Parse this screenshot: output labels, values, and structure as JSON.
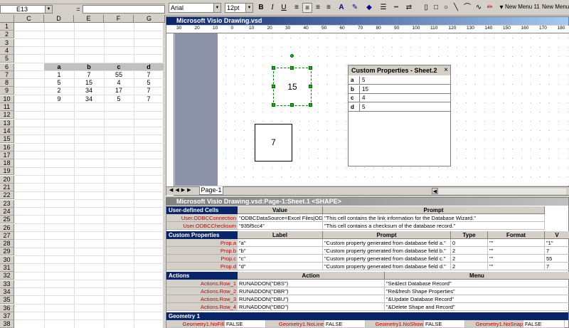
{
  "excel": {
    "name_box": "E13",
    "formula_eq": "=",
    "columns": [
      "C",
      "D",
      "E",
      "F",
      "G"
    ],
    "rows": [
      "1",
      "2",
      "3",
      "4",
      "5",
      "6",
      "7",
      "8",
      "9",
      "10",
      "11",
      "12",
      "13",
      "14",
      "15",
      "16",
      "17",
      "18",
      "19",
      "20",
      "21",
      "22",
      "23",
      "24",
      "25",
      "26",
      "27",
      "28",
      "29",
      "30",
      "31",
      "32",
      "33",
      "34",
      "35",
      "36",
      "37",
      "38"
    ],
    "table_headers": [
      "a",
      "b",
      "c",
      "d"
    ],
    "table_rows": [
      [
        "1",
        "7",
        "55",
        "7"
      ],
      [
        "5",
        "15",
        "4",
        "5"
      ],
      [
        "2",
        "34",
        "17",
        "7"
      ],
      [
        "9",
        "34",
        "5",
        "7"
      ]
    ]
  },
  "toolbar": {
    "font": "Arial",
    "size": "12pt",
    "bold": "B",
    "italic": "I",
    "underline": "U",
    "menu1": "New Menu 11",
    "menu2": "New Menu"
  },
  "visio": {
    "title": "Microsoft Visio Drawing.vsd",
    "ruler_marks": [
      "30",
      "20",
      "10",
      "0",
      "10",
      "20",
      "30",
      "40",
      "50",
      "60",
      "70",
      "80",
      "90",
      "100",
      "110",
      "120",
      "130",
      "140",
      "150",
      "160",
      "170",
      "180"
    ],
    "shape1_text": "15",
    "shape2_text": "7",
    "page_tab": "Page-1"
  },
  "custom_props": {
    "title": "Custom Properties - Sheet.2",
    "close": "×",
    "rows": [
      {
        "k": "a",
        "v": "5"
      },
      {
        "k": "b",
        "v": "15"
      },
      {
        "k": "c",
        "v": "4"
      },
      {
        "k": "d",
        "v": "5"
      }
    ]
  },
  "shapesheet": {
    "title": "Microsoft Visio Drawing.vsd:Page-1:Sheet.1 <SHAPE>",
    "user_section": "User-defined Cells",
    "user_cols": [
      "Value",
      "Prompt"
    ],
    "user_rows": [
      {
        "name": "User.ODBCConnection",
        "value": "\"ODBCDataSource=Excel Files|ODBC",
        "prompt": "\"This cell contains the link information for the Database Wizard.\""
      },
      {
        "name": "User.ODBCChecksum",
        "value": "\"935f5cc4\"",
        "prompt": "\"This cell contains a checksum of the database record.\""
      }
    ],
    "props_section": "Custom Properties",
    "props_cols": [
      "Label",
      "Prompt",
      "Type",
      "Format",
      "V"
    ],
    "props_rows": [
      {
        "name": "Prop.a",
        "label": "\"a\"",
        "prompt": "\"Custom property generated from database field a.\"",
        "type": "0",
        "format": "\"\"",
        "val": "\"1\""
      },
      {
        "name": "Prop.b",
        "label": "\"b\"",
        "prompt": "\"Custom property generated from database field b.\"",
        "type": "2",
        "format": "\"\"",
        "val": "7"
      },
      {
        "name": "Prop.c",
        "label": "\"c\"",
        "prompt": "\"Custom property generated from database field c.\"",
        "type": "2",
        "format": "\"\"",
        "val": "55"
      },
      {
        "name": "Prop.d",
        "label": "\"d\"",
        "prompt": "\"Custom property generated from database field d.\"",
        "type": "2",
        "format": "\"\"",
        "val": "7"
      }
    ],
    "actions_section": "Actions",
    "actions_cols": [
      "Action",
      "Menu"
    ],
    "actions_rows": [
      {
        "name": "Actions.Row_1",
        "action": "RUNADDON(\"DBS\")",
        "menu": "\"Se&lect Database Record\""
      },
      {
        "name": "Actions.Row_2",
        "action": "RUNADDON(\"DBR\")",
        "menu": "\"Re&fresh Shape Properties\""
      },
      {
        "name": "Actions.Row_3",
        "action": "RUNADDON(\"DBU\")",
        "menu": "\"&Update Database Record\""
      },
      {
        "name": "Actions.Row_4",
        "action": "RUNADDON(\"DBD\")",
        "menu": "\"&Delete Shape and Record\""
      }
    ],
    "geometry_section": "Geometry 1",
    "geometry_cells": [
      "Geometry1.NoFill",
      "FALSE",
      "Geometry1.NoLine",
      "FALSE",
      "Geometry1.NoShow",
      "FALSE",
      "Geometry1.NoSnap",
      "FALSE"
    ]
  }
}
